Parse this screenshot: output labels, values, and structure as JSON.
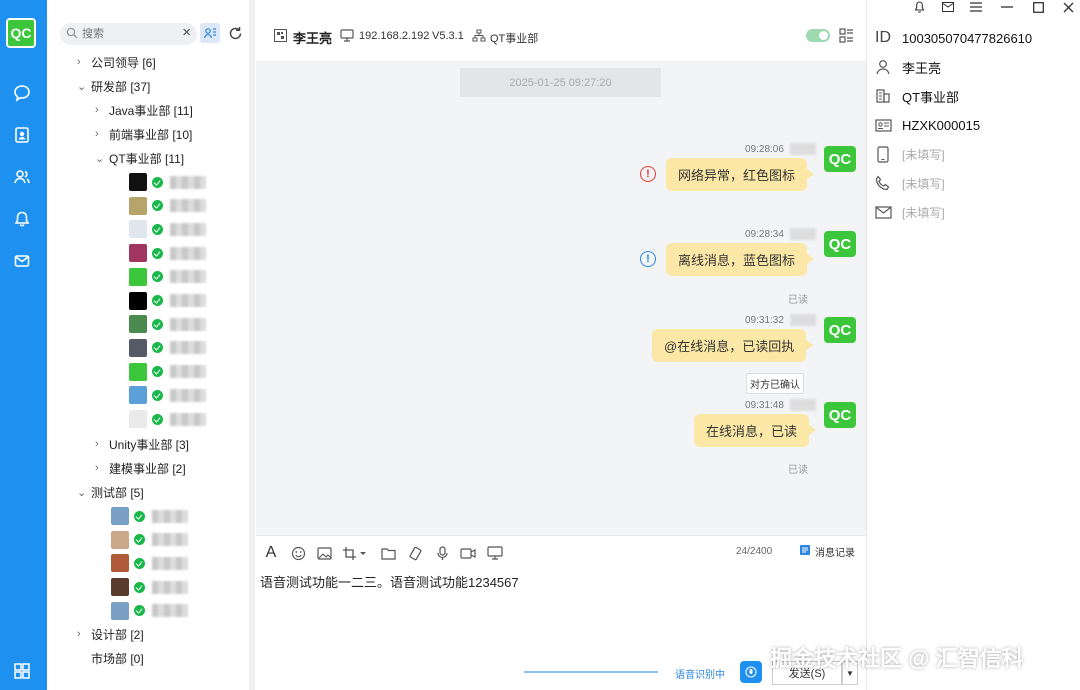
{
  "app": {
    "logo_text": "QC"
  },
  "rail": {
    "items": [
      "chat-icon",
      "contacts-icon",
      "group-icon",
      "bell-icon",
      "mail-icon"
    ],
    "bottom": "grid-icon"
  },
  "search": {
    "placeholder": "搜索",
    "clear": "×"
  },
  "tree": {
    "company_leaders": "公司领导 [6]",
    "rnd": "研发部 [37]",
    "java": "Java事业部 [11]",
    "frontend": "前端事业部 [10]",
    "qt": "QT事业部 [11]",
    "unity": "Unity事业部 [3]",
    "modeling": "建模事业部 [2]",
    "testing": "测试部 [5]",
    "design": "设计部 [2]",
    "market": "市场部 [0]",
    "qt_member_avatars": [
      "#111",
      "#b7a46a",
      "#dfe6ee",
      "#a0355f",
      "#3cc63c",
      "#000",
      "#4b8a4e",
      "#555a66",
      "#3cc63c",
      "#5ba0d8",
      "#eaeaea"
    ],
    "testing_member_avatars": [
      "#7aa0c6",
      "#c9a98a",
      "#b05a3a",
      "#5a3c2c",
      "#7aa0c6"
    ]
  },
  "chat": {
    "contact_name": "李王亮",
    "ip": "192.168.2.192",
    "version": "V5.3.1",
    "dept": "QT事业部",
    "time_separator": "2025-01-25 09:27:20",
    "messages": [
      {
        "time": "09:28:06",
        "text": "网络异常，红色图标",
        "status": "!",
        "status_color": "#e53935"
      },
      {
        "time": "09:28:34",
        "text": "离线消息，蓝色图标",
        "status": "!",
        "status_color": "#2a86e0",
        "read": "已读"
      },
      {
        "time": "09:31:32",
        "text": "@在线消息，已读回执",
        "confirm": "对方已确认"
      },
      {
        "time": "09:31:48",
        "text": "在线消息，已读",
        "read": "已读"
      }
    ],
    "avatar_text": "QC"
  },
  "composer": {
    "counter": "24/2400",
    "history": "消息记录",
    "input_text": "语音测试功能一二三。语音测试功能1234567",
    "voice_status": "语音识别中",
    "send": "发送(S)",
    "font_tool": "A"
  },
  "profile": {
    "id": "100305070477826610",
    "name": "李王亮",
    "dept": "QT事业部",
    "code": "HZXK000015",
    "mobile": "[未填写]",
    "phone": "[未填写]",
    "email": "[未填写]",
    "id_label": "ID"
  },
  "watermark": "掘金技术社区 @ 汇智信科"
}
